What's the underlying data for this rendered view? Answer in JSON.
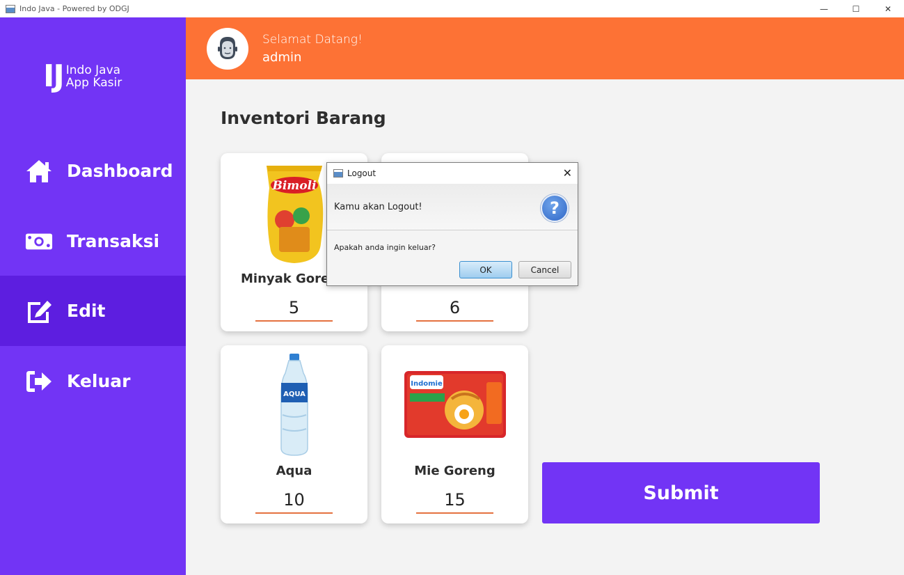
{
  "window": {
    "title": "Indo Java - Powered by ODGJ",
    "controls": [
      "—",
      "☐",
      "✕"
    ]
  },
  "sidebar": {
    "logo_mark": "IJ",
    "logo_line1": "Indo Java",
    "logo_line2": "App Kasir",
    "items": [
      {
        "label": "Dashboard",
        "icon": "home-icon"
      },
      {
        "label": "Transaksi",
        "icon": "money-icon"
      },
      {
        "label": "Edit",
        "icon": "edit-icon",
        "active": true
      },
      {
        "label": "Keluar",
        "icon": "sign-out-icon"
      }
    ]
  },
  "header": {
    "welcome": "Selamat Datang!",
    "username": "admin"
  },
  "main": {
    "title": "Inventori Barang",
    "products": [
      {
        "name": "Minyak Goreng",
        "qty": "5",
        "image": "minyak-goreng-image"
      },
      {
        "name": "",
        "qty": "6",
        "image": "product-image"
      },
      {
        "name": "Aqua",
        "qty": "10",
        "image": "aqua-bottle-image"
      },
      {
        "name": "Mie Goreng",
        "qty": "15",
        "image": "mie-goreng-image"
      }
    ],
    "submit_label": "Submit"
  },
  "dialog": {
    "title": "Logout",
    "heading": "Kamu akan Logout!",
    "content": "Apakah anda ingin keluar?",
    "ok_label": "OK",
    "cancel_label": "Cancel",
    "close": "✕",
    "icon_glyph": "?"
  },
  "colors": {
    "sidebar": "#7234f5",
    "sidebar_active": "#5d1ee0",
    "header": "#fd7235",
    "accent_underline": "#e5713f"
  }
}
